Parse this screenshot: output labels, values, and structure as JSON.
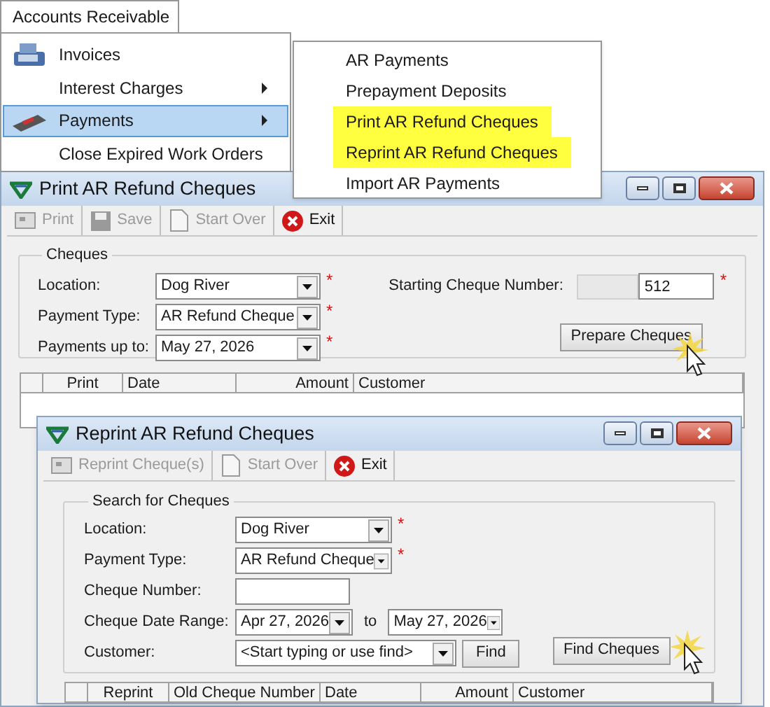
{
  "menu": {
    "title": "Accounts Receivable",
    "items": [
      {
        "label": "Invoices",
        "submenu": false,
        "selected": false
      },
      {
        "label": "Interest Charges",
        "submenu": true,
        "selected": false
      },
      {
        "label": "Payments",
        "submenu": true,
        "selected": true
      },
      {
        "label": "Close Expired Work Orders",
        "submenu": false,
        "selected": false
      }
    ]
  },
  "submenu": {
    "items": [
      {
        "label": "AR Payments",
        "highlighted": false
      },
      {
        "label": "Prepayment Deposits",
        "highlighted": false
      },
      {
        "label": "Print AR Refund Cheques",
        "highlighted": true
      },
      {
        "label": "Reprint AR Refund Cheques",
        "highlighted": true
      },
      {
        "label": "Import AR Payments",
        "highlighted": false
      }
    ]
  },
  "print_window": {
    "title": "Print AR Refund Cheques",
    "toolbar": [
      {
        "label": "Print",
        "kind": "print",
        "disabled": true
      },
      {
        "label": "Save",
        "kind": "save",
        "disabled": true
      },
      {
        "label": "Start Over",
        "kind": "page",
        "disabled": true
      },
      {
        "label": "Exit",
        "kind": "exit",
        "disabled": false
      }
    ],
    "group": {
      "title": "Cheques",
      "fields": [
        {
          "label": "Location:",
          "kind": "combo",
          "value": "Dog River",
          "required": "*"
        },
        {
          "label": "Payment Type:",
          "kind": "combo",
          "value": "AR Refund Cheque",
          "required": "*"
        },
        {
          "label": "Payments up to:",
          "kind": "combo",
          "value": "May 27, 2026",
          "required": "*"
        }
      ],
      "starting_cheque": {
        "label": "Starting Cheque Number:",
        "value": "512",
        "required": "*"
      },
      "button": "Prepare Cheques"
    },
    "columns": [
      "",
      "Print",
      "Date",
      "Amount",
      "Customer"
    ]
  },
  "reprint_window": {
    "title": "Reprint AR Refund Cheques",
    "toolbar": [
      {
        "label": "Reprint Cheque(s)",
        "kind": "print",
        "disabled": true
      },
      {
        "label": "Start Over",
        "kind": "page",
        "disabled": true
      },
      {
        "label": "Exit",
        "kind": "exit",
        "disabled": false
      }
    ],
    "group": {
      "title": "Search for Cheques",
      "fields": [
        {
          "label": "Location:",
          "kind": "combo",
          "value": "Dog River",
          "required": "*"
        },
        {
          "label": "Payment Type:",
          "kind": "combo",
          "value": "AR Refund Cheque",
          "required": "*"
        },
        {
          "label": "Cheque Number:",
          "kind": "text"
        },
        {
          "label": "Cheque Date Range:",
          "kind": "range",
          "value": "Apr 27, 2026",
          "separator": "to",
          "value_2": "May 27, 2026"
        },
        {
          "label": "Customer:",
          "kind": "customer",
          "value": "<Start typing or use find>",
          "find": "Find"
        }
      ],
      "button": "Find Cheques"
    },
    "columns": [
      "",
      "Reprint",
      "Old Cheque Number",
      "Date",
      "Amount",
      "Customer"
    ]
  }
}
